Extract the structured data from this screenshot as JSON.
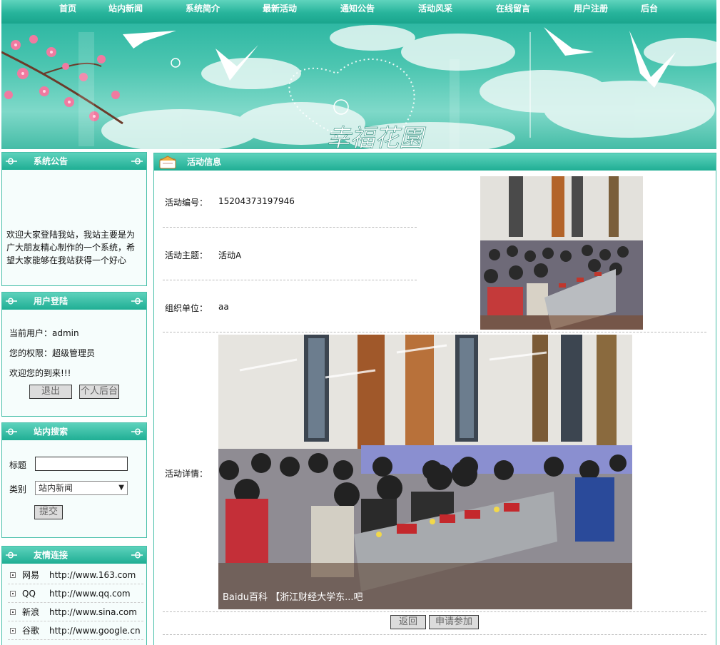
{
  "nav": {
    "items": [
      "首页",
      "站内新闻",
      "系统简介",
      "最新活动",
      "通知公告",
      "活动风采",
      "在线留言",
      "用户注册",
      "后台"
    ]
  },
  "banner": {
    "title_art": "幸福花園"
  },
  "notice": {
    "title": "系统公告",
    "text": "欢迎大家登陆我站，我站主要是为广大朋友精心制作的一个系统，希望大家能够在我站获得一个好心"
  },
  "login": {
    "title": "用户登陆",
    "current_user": "当前用户：admin",
    "role": "您的权限：超级管理员",
    "welcome": "欢迎您的到来!!!",
    "logout_label": "退出",
    "backend_label": "个人后台"
  },
  "search": {
    "title": "站内搜索",
    "title_label": "标题",
    "title_value": "",
    "category_label": "类别",
    "category_selected": "站内新闻",
    "submit_label": "提交"
  },
  "links": {
    "title": "友情连接",
    "items": [
      {
        "name": "网易",
        "url": "http://www.163.com"
      },
      {
        "name": "QQ",
        "url": "http://www.qq.com"
      },
      {
        "name": "新浪",
        "url": "http://www.sina.com"
      },
      {
        "name": "谷歌",
        "url": "http://www.google.cn"
      }
    ]
  },
  "activity": {
    "header": "活动信息",
    "id_label": "活动编号：",
    "id_value": "15204373197946",
    "topic_label": "活动主题：",
    "topic_value": "活动A",
    "org_label": "组织单位：",
    "org_value": "aa",
    "detail_label": "活动详情：",
    "watermark": "Baidu百科 【浙江财经大学东...吧",
    "back_label": "返回",
    "apply_label": "申请参加"
  },
  "colors": {
    "accent": "#1fae94",
    "border": "#47bfa9"
  }
}
